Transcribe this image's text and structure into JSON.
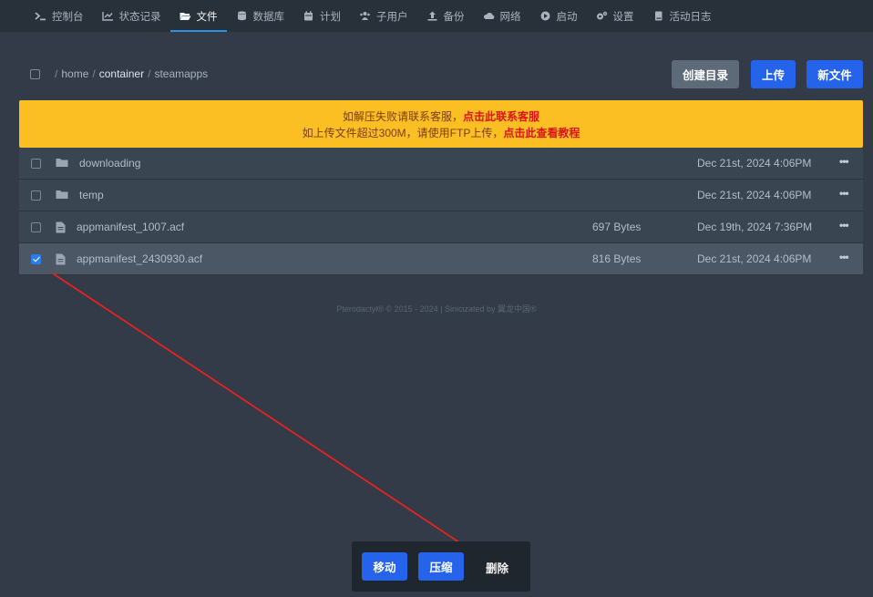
{
  "nav": {
    "items": [
      {
        "label": "控制台",
        "icon": "terminal-icon"
      },
      {
        "label": "状态记录",
        "icon": "chart-line-icon"
      },
      {
        "label": "文件",
        "icon": "folder-open-icon",
        "active": true
      },
      {
        "label": "数据库",
        "icon": "database-icon"
      },
      {
        "label": "计划",
        "icon": "calendar-icon"
      },
      {
        "label": "子用户",
        "icon": "users-icon"
      },
      {
        "label": "备份",
        "icon": "upload-icon"
      },
      {
        "label": "网络",
        "icon": "cloud-icon"
      },
      {
        "label": "启动",
        "icon": "play-circle-icon"
      },
      {
        "label": "设置",
        "icon": "gears-icon"
      },
      {
        "label": "活动日志",
        "icon": "book-icon"
      }
    ]
  },
  "path": {
    "root_sep": "/",
    "segments": [
      "home",
      "container",
      "steamapps"
    ]
  },
  "toolbar": {
    "create_dir": "创建目录",
    "upload": "上传",
    "new_file": "新文件"
  },
  "notice": {
    "line1_text": "如解压失败请联系客服，",
    "line1_link": "点击此联系客服",
    "line2_text": "如上传文件超过300M，请使用FTP上传，",
    "line2_link": "点击此查看教程"
  },
  "files": [
    {
      "name": "downloading",
      "type": "folder",
      "size": "",
      "date": "Dec 21st, 2024 4:06PM",
      "selected": false
    },
    {
      "name": "temp",
      "type": "folder",
      "size": "",
      "date": "Dec 21st, 2024 4:06PM",
      "selected": false
    },
    {
      "name": "appmanifest_1007.acf",
      "type": "file",
      "size": "697 Bytes",
      "date": "Dec 19th, 2024 7:36PM",
      "selected": false
    },
    {
      "name": "appmanifest_2430930.acf",
      "type": "file",
      "size": "816 Bytes",
      "date": "Dec 21st, 2024 4:06PM",
      "selected": true
    }
  ],
  "row_menu": "•••",
  "footer": "Pterodactyl® © 2015 - 2024 | Sinicizated by 翼龙中国®",
  "actions": {
    "move": "移动",
    "compress": "压缩",
    "delete": "删除"
  },
  "colors": {
    "accent": "#2563eb",
    "notice_bg": "#fbbf24",
    "notice_link": "#dc1414",
    "annotation_arrow": "#e8231f"
  }
}
